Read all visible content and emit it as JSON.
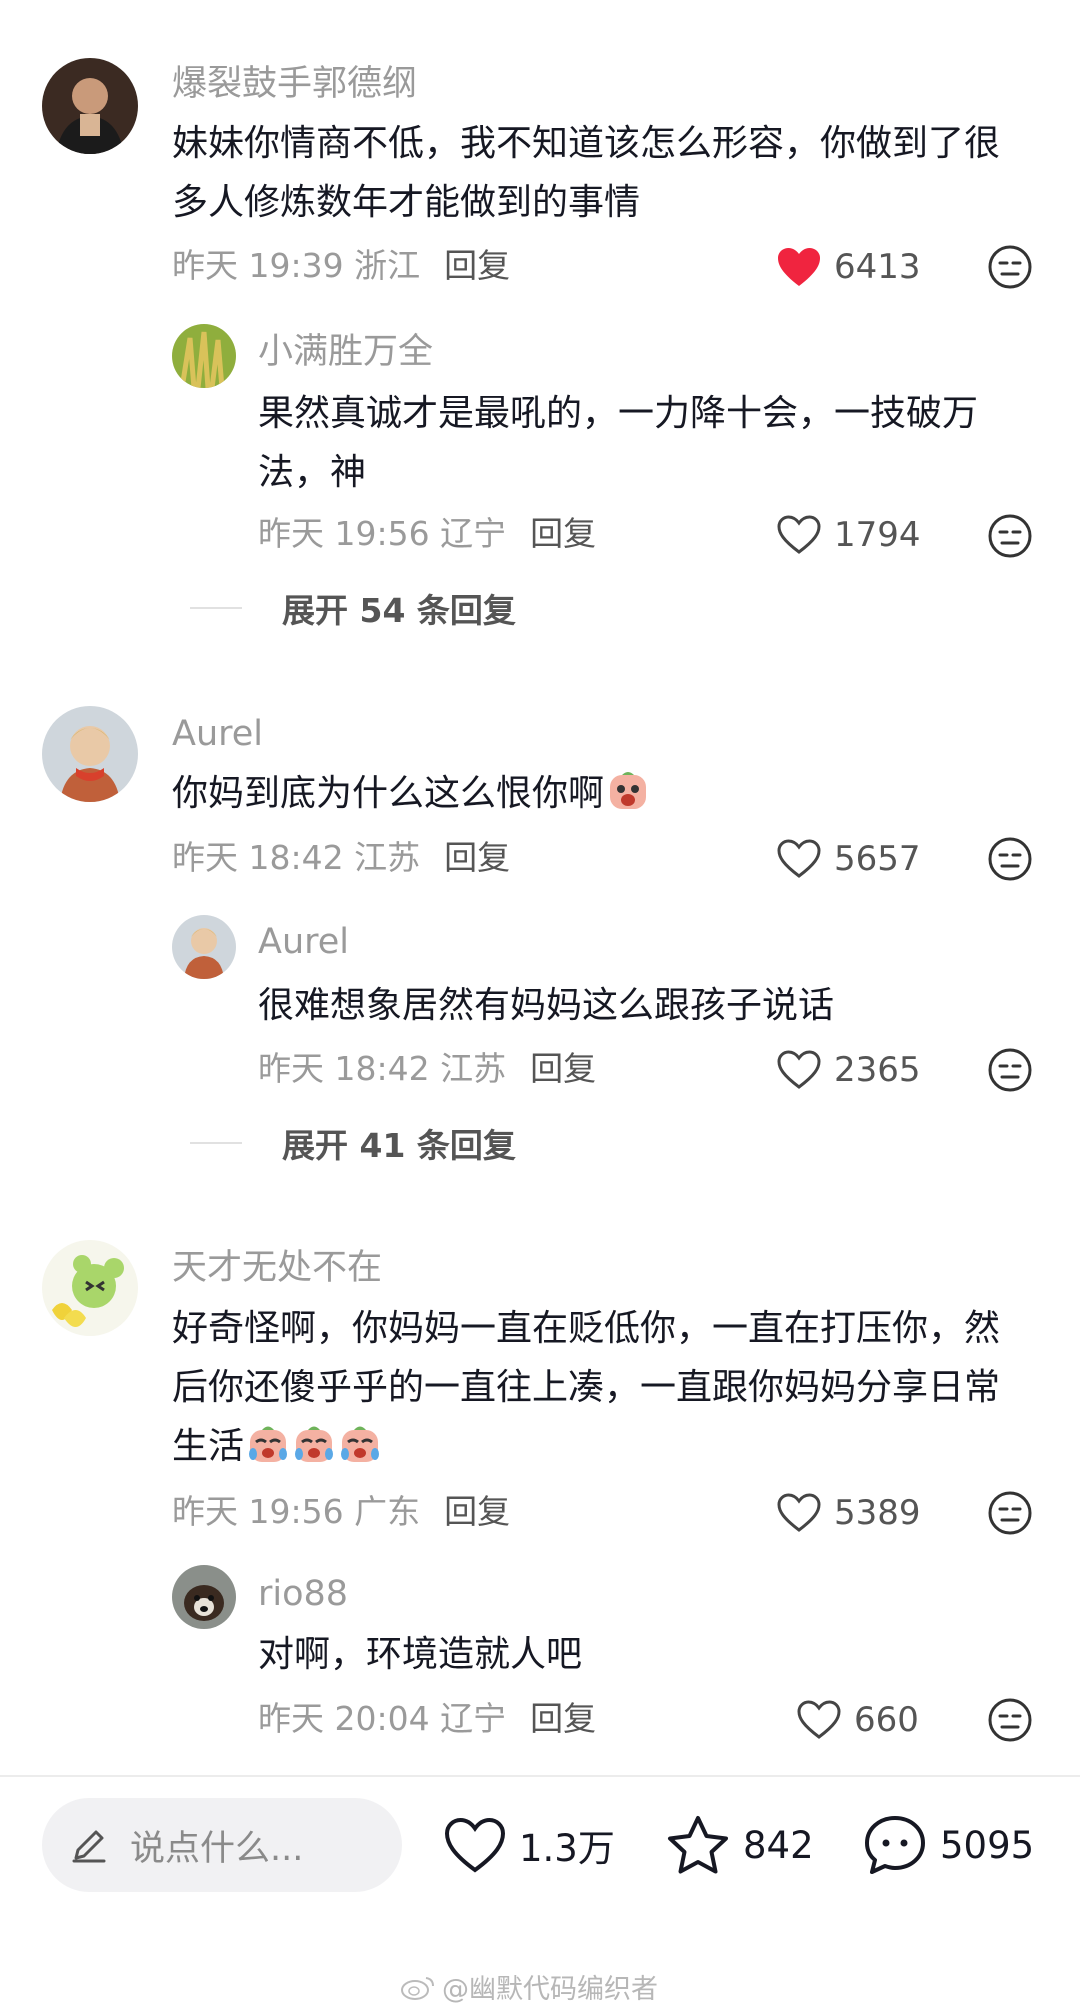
{
  "comments": [
    {
      "user": "爆裂鼓手郭德纲",
      "text": "妹妹你情商不低，我不知道该怎么形容，你做到了很多人修炼数年才能做到的事情",
      "time": "昨天 19:39 浙江",
      "reply": "回复",
      "likes": "6413",
      "liked": true
    },
    {
      "user": "小满胜万全",
      "text": "果然真诚才是最吼的，一力降十会，一技破万法，神",
      "time": "昨天 19:56 辽宁",
      "reply": "回复",
      "likes": "1794",
      "liked": false
    },
    {
      "user": "Aurel",
      "text": "你妈到底为什么这么恨你啊",
      "time": "昨天 18:42 江苏",
      "reply": "回复",
      "likes": "5657",
      "liked": false
    },
    {
      "user": "Aurel",
      "text": "很难想象居然有妈妈这么跟孩子说话",
      "time": "昨天 18:42 江苏",
      "reply": "回复",
      "likes": "2365",
      "liked": false
    },
    {
      "user": "天才无处不在",
      "text": "好奇怪啊，你妈妈一直在贬低你，一直在打压你，然后你还傻乎乎的一直往上凑，一直跟你妈妈分享日常生活",
      "time": "昨天 19:56 广东",
      "reply": "回复",
      "likes": "5389",
      "liked": false
    },
    {
      "user": "rio88",
      "text": "对啊，环境造就人吧",
      "time": "昨天 20:04 辽宁",
      "reply": "回复",
      "likes": "660",
      "liked": false
    }
  ],
  "expand": [
    "展开 54 条回复",
    "展开 41 条回复"
  ],
  "bottom_bar": {
    "placeholder": "说点什么...",
    "likes": "1.3万",
    "favorites": "842",
    "comments": "5095"
  },
  "watermark": "@幽默代码编织者",
  "colors": {
    "liked_heart": "#f0243f",
    "muted_text": "#9a9a9a",
    "input_bg": "#f1f1f3"
  }
}
